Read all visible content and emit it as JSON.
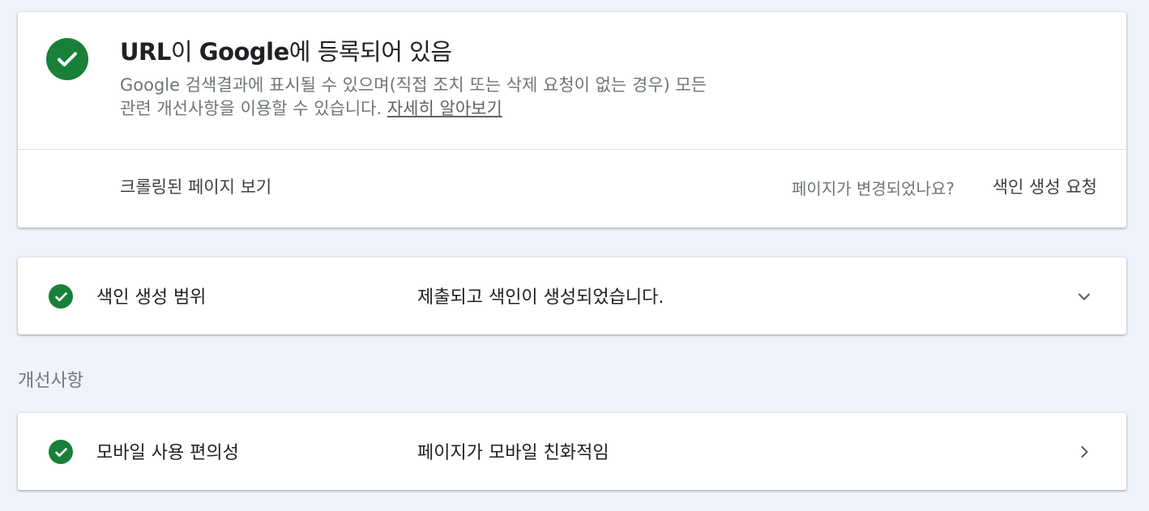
{
  "status": {
    "title_bold_1": "URL",
    "title_plain_1": "이 ",
    "title_bold_2": "Google",
    "title_plain_2": "에 등록되어 있음",
    "description_line_1": "Google 검색결과에 표시될 수 있으며(직접 조치 또는 삭제 요청이 없는 경우) 모든",
    "description_line_2": "관련 개선사항을 이용할 수 있습니다. ",
    "learn_more": "자세히 알아보기",
    "view_crawled_page": "크롤링된 페이지 보기",
    "page_changed_question": "페이지가 변경되었나요?",
    "request_indexing": "색인 생성 요청"
  },
  "coverage": {
    "label": "색인 생성 범위",
    "value": "제출되고 색인이 생성되었습니다."
  },
  "enhancements": {
    "heading": "개선사항",
    "items": [
      {
        "label": "모바일 사용 편의성",
        "value": "페이지가 모바일 친화적임"
      }
    ]
  },
  "icons": {
    "status_icon": "check-circle-icon",
    "coverage_expand_icon": "chevron-down-icon",
    "mobile_open_icon": "chevron-right-icon"
  },
  "colors": {
    "success_green": "#188038",
    "background": "#eff3fb",
    "card": "#ffffff",
    "secondary_text": "#70757a"
  }
}
